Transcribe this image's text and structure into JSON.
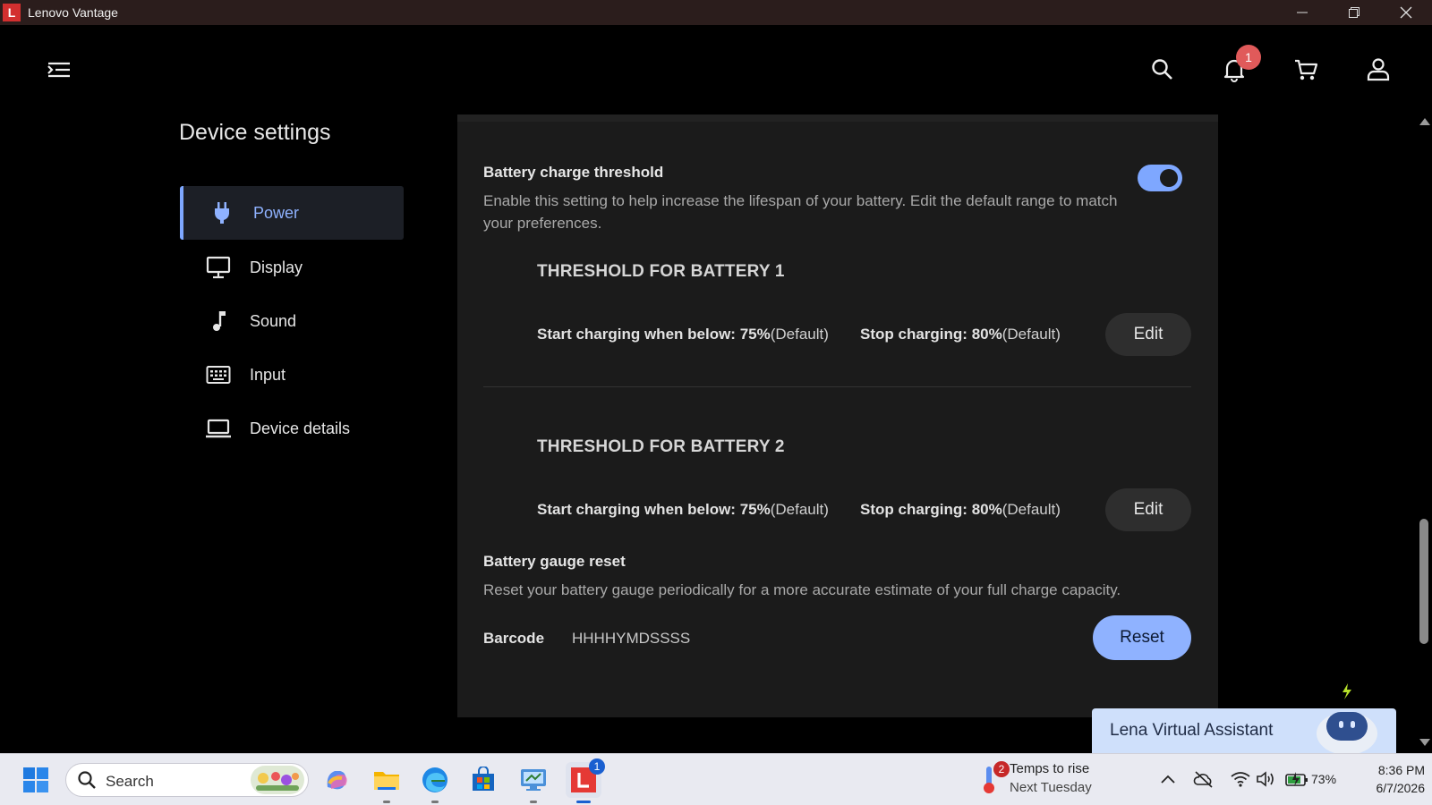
{
  "window": {
    "title": "Lenovo Vantage",
    "logo_letter": "L"
  },
  "topbar": {
    "notification_count": "1"
  },
  "sidebar": {
    "title": "Device settings",
    "items": [
      {
        "label": "Power",
        "icon": "plug-icon",
        "active": true
      },
      {
        "label": "Display",
        "icon": "monitor-icon"
      },
      {
        "label": "Sound",
        "icon": "music-note-icon"
      },
      {
        "label": "Input",
        "icon": "keyboard-icon"
      },
      {
        "label": "Device details",
        "icon": "laptop-icon"
      }
    ]
  },
  "battery_threshold": {
    "title": "Battery charge threshold",
    "description": "Enable this setting to help increase the lifespan of your battery. Edit the default range to match your preferences.",
    "enabled": true,
    "batteries": [
      {
        "title": "THRESHOLD FOR BATTERY 1",
        "start_label": "Start charging when below:",
        "start_value": "75%",
        "start_suffix": "(Default)",
        "stop_label": "Stop charging:",
        "stop_value": "80%",
        "stop_suffix": "(Default)",
        "edit_label": "Edit"
      },
      {
        "title": "THRESHOLD FOR BATTERY 2",
        "start_label": "Start charging when below:",
        "start_value": "75%",
        "start_suffix": "(Default)",
        "stop_label": "Stop charging:",
        "stop_value": "80%",
        "stop_suffix": "(Default)",
        "edit_label": "Edit"
      }
    ]
  },
  "gauge_reset": {
    "title": "Battery gauge reset",
    "description": "Reset your battery gauge periodically for a more accurate estimate of your full charge capacity.",
    "barcode_label": "Barcode",
    "barcode_value": "HHHHYMDSSSS",
    "reset_label": "Reset"
  },
  "assistant": {
    "label": "Lena Virtual Assistant"
  },
  "taskbar": {
    "search_placeholder": "Search",
    "lenovo_badge": "1",
    "weather_badge": "2",
    "weather_line1": "Temps to rise",
    "weather_line2": "Next Tuesday",
    "battery_percent": "73%",
    "time": "8:36 PM",
    "date": "6/7/2026"
  },
  "colors": {
    "accent": "#7ea7ff",
    "panel": "#1b1b1b",
    "titlebar": "#2b1d1c",
    "badge": "#e05a5a"
  }
}
